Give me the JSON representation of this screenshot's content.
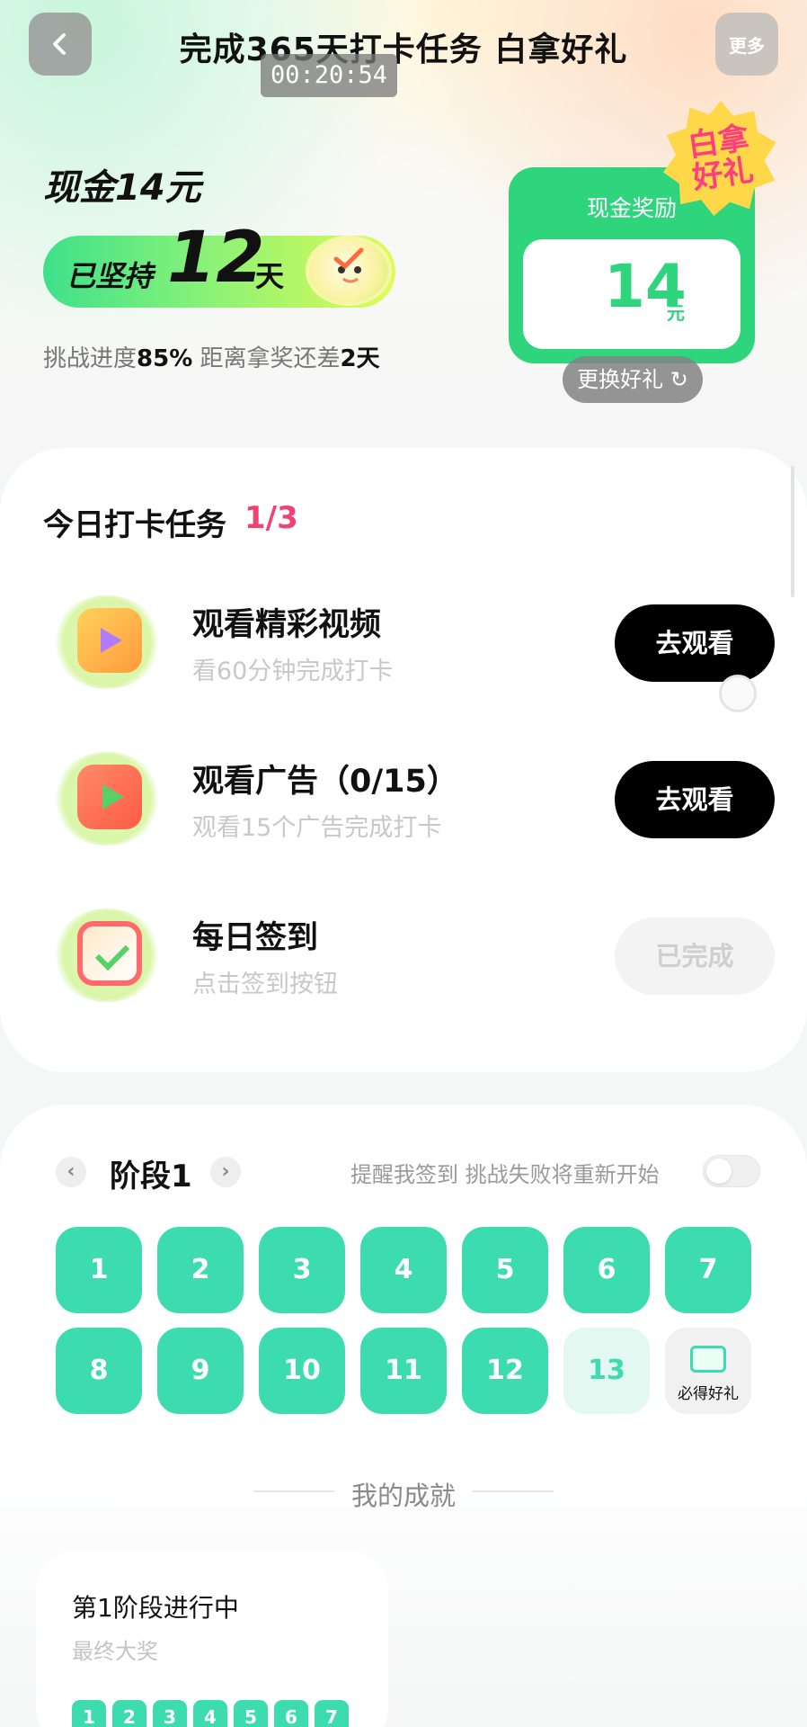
{
  "header": {
    "title": "完成365天打卡任务 白拿好礼",
    "more_label": "更多",
    "timer": "00:20:54"
  },
  "hero": {
    "cash_title": "现金14元",
    "streak_prefix": "已坚持",
    "streak_days": "12",
    "streak_suffix": "天",
    "progress_label": "挑战进度",
    "progress_value": "85%",
    "remaining_label": " 距离拿奖还差",
    "remaining_value": "2天",
    "progress_fraction": 0.85
  },
  "reward": {
    "label": "现金奖励",
    "value": "14",
    "unit": "元",
    "badge": "白拿好礼",
    "change_label": "更换好礼"
  },
  "tasks": {
    "title": "今日打卡任务",
    "count": "1/3",
    "items": [
      {
        "name": "观看精彩视频",
        "desc": "看60分钟完成打卡",
        "button": "去观看",
        "icon": "video-icon",
        "done": false
      },
      {
        "name": "观看广告（0/15）",
        "desc": "观看15个广告完成打卡",
        "button": "去观看",
        "icon": "ad-icon",
        "done": false
      },
      {
        "name": "每日签到",
        "desc": "点击签到按钮",
        "button": "已完成",
        "icon": "calendar-icon",
        "done": true
      }
    ]
  },
  "stage": {
    "name": "阶段1",
    "remind_text": "提醒我签到 挑战失败将重新开始",
    "remind_on": false,
    "days": [
      "1",
      "2",
      "3",
      "4",
      "5",
      "6",
      "7",
      "8",
      "9",
      "10",
      "11",
      "12",
      "13"
    ],
    "completed_days": 12,
    "gift_label": "必得好礼"
  },
  "achievement": {
    "title": "我的成就",
    "card_title": "第1阶段进行中",
    "card_subtitle": "最终大奖",
    "mini_days": [
      "1",
      "2",
      "3",
      "4",
      "5",
      "6",
      "7"
    ]
  },
  "colors": {
    "accent_green": "#2fd57c",
    "day_teal": "#3ddcb0",
    "count_pink": "#f04373"
  }
}
